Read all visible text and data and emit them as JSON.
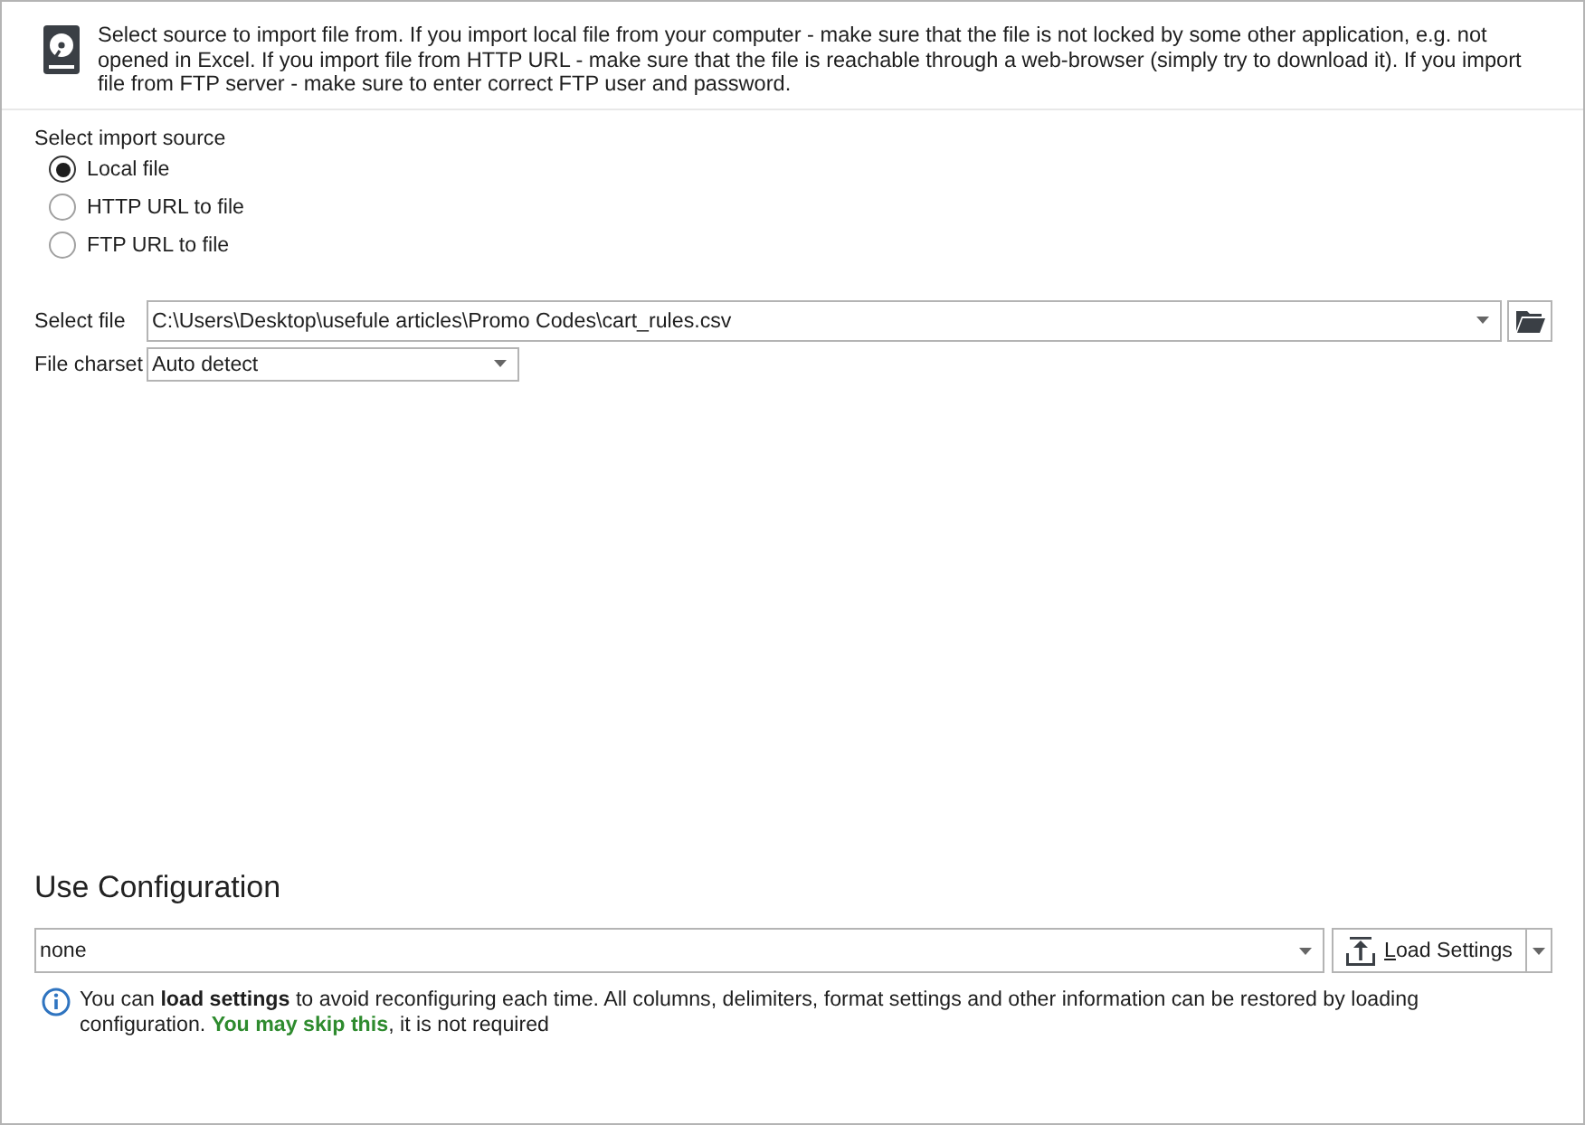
{
  "header": {
    "text": "Select source to import file from. If you import local file from your computer - make sure that the file is not locked by some other application, e.g. not opened in Excel. If you import file from HTTP URL - make sure that the file is reachable through a web-browser (simply try to download it). If you import file from FTP server - make sure to enter correct FTP user and password."
  },
  "import_source": {
    "label": "Select import source",
    "options": [
      {
        "label": "Local file",
        "selected": true
      },
      {
        "label": "HTTP URL to file",
        "selected": false
      },
      {
        "label": "FTP URL to file",
        "selected": false
      }
    ]
  },
  "select_file": {
    "label": "Select file",
    "value": "C:\\Users\\Desktop\\usefule articles\\Promo Codes\\cart_rules.csv"
  },
  "file_charset": {
    "label": "File charset",
    "value": "Auto detect"
  },
  "configuration": {
    "title": "Use Configuration",
    "value": "none",
    "button": "Load Settings",
    "info": [
      {
        "kind": "plain",
        "text": "You can "
      },
      {
        "kind": "bold",
        "text": "load settings"
      },
      {
        "kind": "plain",
        "text": " to avoid reconfiguring each time. All columns, delimiters, format settings and other information can be restored by loading configuration. "
      },
      {
        "kind": "highlight",
        "text": "You may skip this"
      },
      {
        "kind": "plain",
        "text": ", it is not required"
      }
    ]
  }
}
